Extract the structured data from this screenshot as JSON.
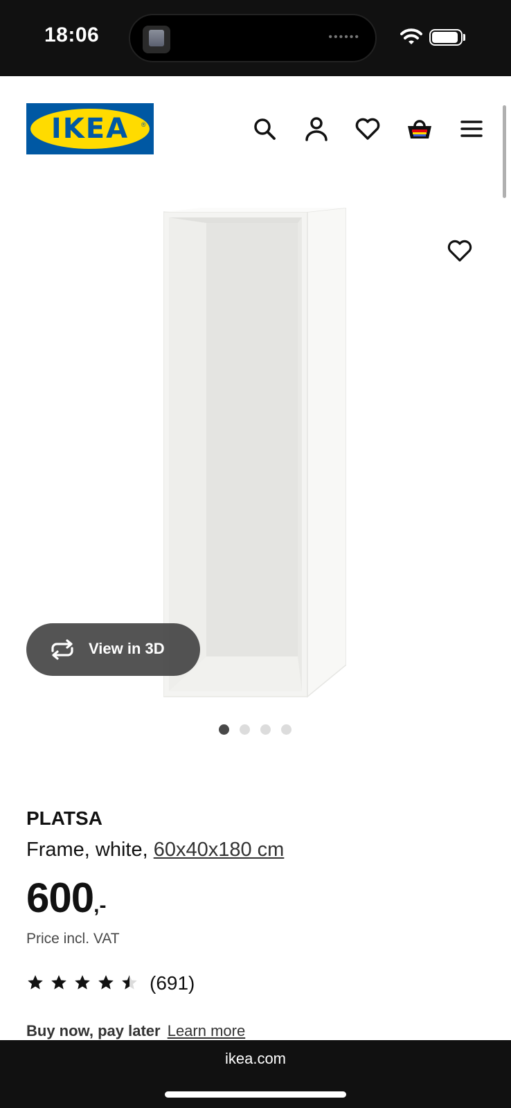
{
  "status_bar": {
    "time": "18:06",
    "island_dots": "••••••",
    "icons": [
      "wifi-icon",
      "battery-icon"
    ]
  },
  "header": {
    "logo_text": "IKEA",
    "logo_registered": "®",
    "icons": [
      "search-icon",
      "account-icon",
      "favourites-icon",
      "cart-icon",
      "menu-icon"
    ]
  },
  "gallery": {
    "view_3d_label": "View in 3D",
    "image_count": 4,
    "active_index": 0
  },
  "product": {
    "name": "PLATSA",
    "description_prefix": "Frame, white, ",
    "size_link": "60x40x180 cm",
    "price": "600",
    "price_suffix": ",-",
    "vat_note": "Price incl. VAT",
    "rating": 4.5,
    "rating_max": 5,
    "review_count": "(691)"
  },
  "financing": {
    "title": "Buy now, pay later",
    "link": "Learn more"
  },
  "browser": {
    "url": "ikea.com"
  },
  "colors": {
    "ikea_blue": "#0058a3",
    "ikea_yellow": "#ffdb00",
    "cart_red": "#e30613",
    "cart_blue": "#3b5bdb"
  }
}
